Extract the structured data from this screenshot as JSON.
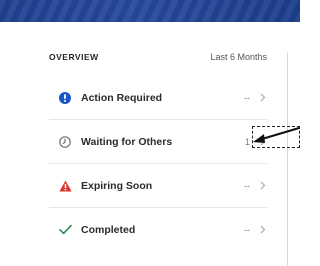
{
  "panel": {
    "title": "OVERVIEW",
    "range": "Last 6 Months"
  },
  "rows": [
    {
      "label": "Action Required",
      "count": "--",
      "icon": "info-circle-icon",
      "icon_color": "#1a55c4"
    },
    {
      "label": "Waiting for Others",
      "count": "1",
      "icon": "clock-icon",
      "icon_color": "#707070"
    },
    {
      "label": "Expiring Soon",
      "count": "--",
      "icon": "warning-triangle-icon",
      "icon_color": "#d9342b"
    },
    {
      "label": "Completed",
      "count": "--",
      "icon": "checkmark-icon",
      "icon_color": "#2e8b57"
    }
  ],
  "colors": {
    "banner": "#1f3f8f",
    "text": "#2b2b2b",
    "muted": "#7a7a7a",
    "divider": "#e6e6e6"
  }
}
